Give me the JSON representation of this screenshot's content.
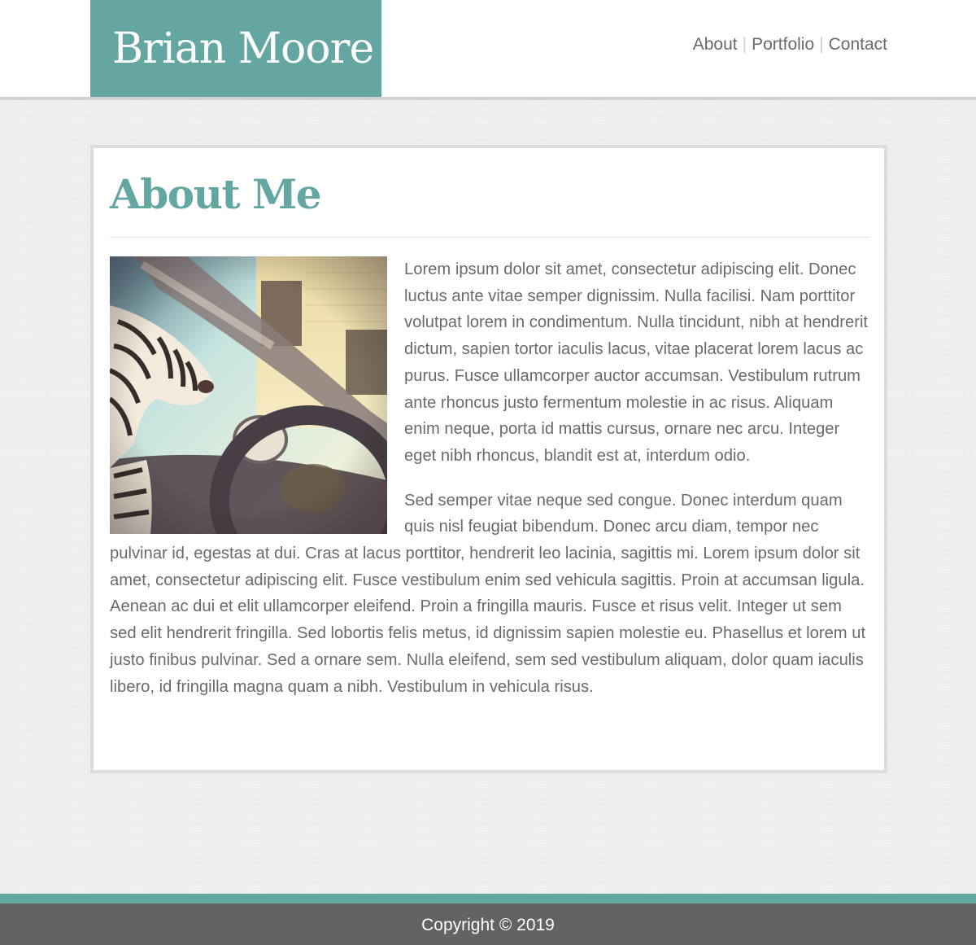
{
  "site": {
    "brand_name": "Brian Moore",
    "accent_color": "#64a6a2"
  },
  "nav": {
    "items": [
      {
        "label": "About"
      },
      {
        "label": "Portfolio"
      },
      {
        "label": "Contact"
      }
    ],
    "separator": "|"
  },
  "main": {
    "title": "About Me",
    "photo": {
      "icon": "zebra-figure-driving-car-photo"
    },
    "paragraphs": [
      "Lorem ipsum dolor sit amet, consectetur adipiscing elit. Donec luctus ante vitae semper dignissim. Nulla facilisi. Nam porttitor volutpat lorem in condimentum. Nulla tincidunt, nibh at hendrerit dictum, sapien tortor iaculis lacus, vitae placerat lorem lacus ac purus. Fusce ullamcorper auctor accumsan. Vestibulum rutrum ante rhoncus justo fermentum molestie in ac risus. Aliquam enim neque, porta id mattis cursus, ornare nec arcu. Integer eget nibh rhoncus, blandit est at, interdum odio.",
      "Sed semper vitae neque sed congue. Donec interdum quam quis nisl feugiat bibendum. Donec arcu diam, tempor nec pulvinar id, egestas at dui. Cras at lacus porttitor, hendrerit leo lacinia, sagittis mi. Lorem ipsum dolor sit amet, consectetur adipiscing elit. Fusce vestibulum enim sed vehicula sagittis. Proin at accumsan ligula. Aenean ac dui et elit ullamcorper eleifend. Proin a fringilla mauris. Fusce et risus velit. Integer ut sem sed elit hendrerit fringilla. Sed lobortis felis metus, id dignissim sapien molestie eu. Phasellus et lorem ut justo finibus pulvinar. Sed a ornare sem. Nulla eleifend, sem sed vestibulum aliquam, dolor quam iaculis libero, id fringilla magna quam a nibh. Vestibulum in vehicula risus."
    ]
  },
  "footer": {
    "copyright": "Copyright © 2019"
  }
}
